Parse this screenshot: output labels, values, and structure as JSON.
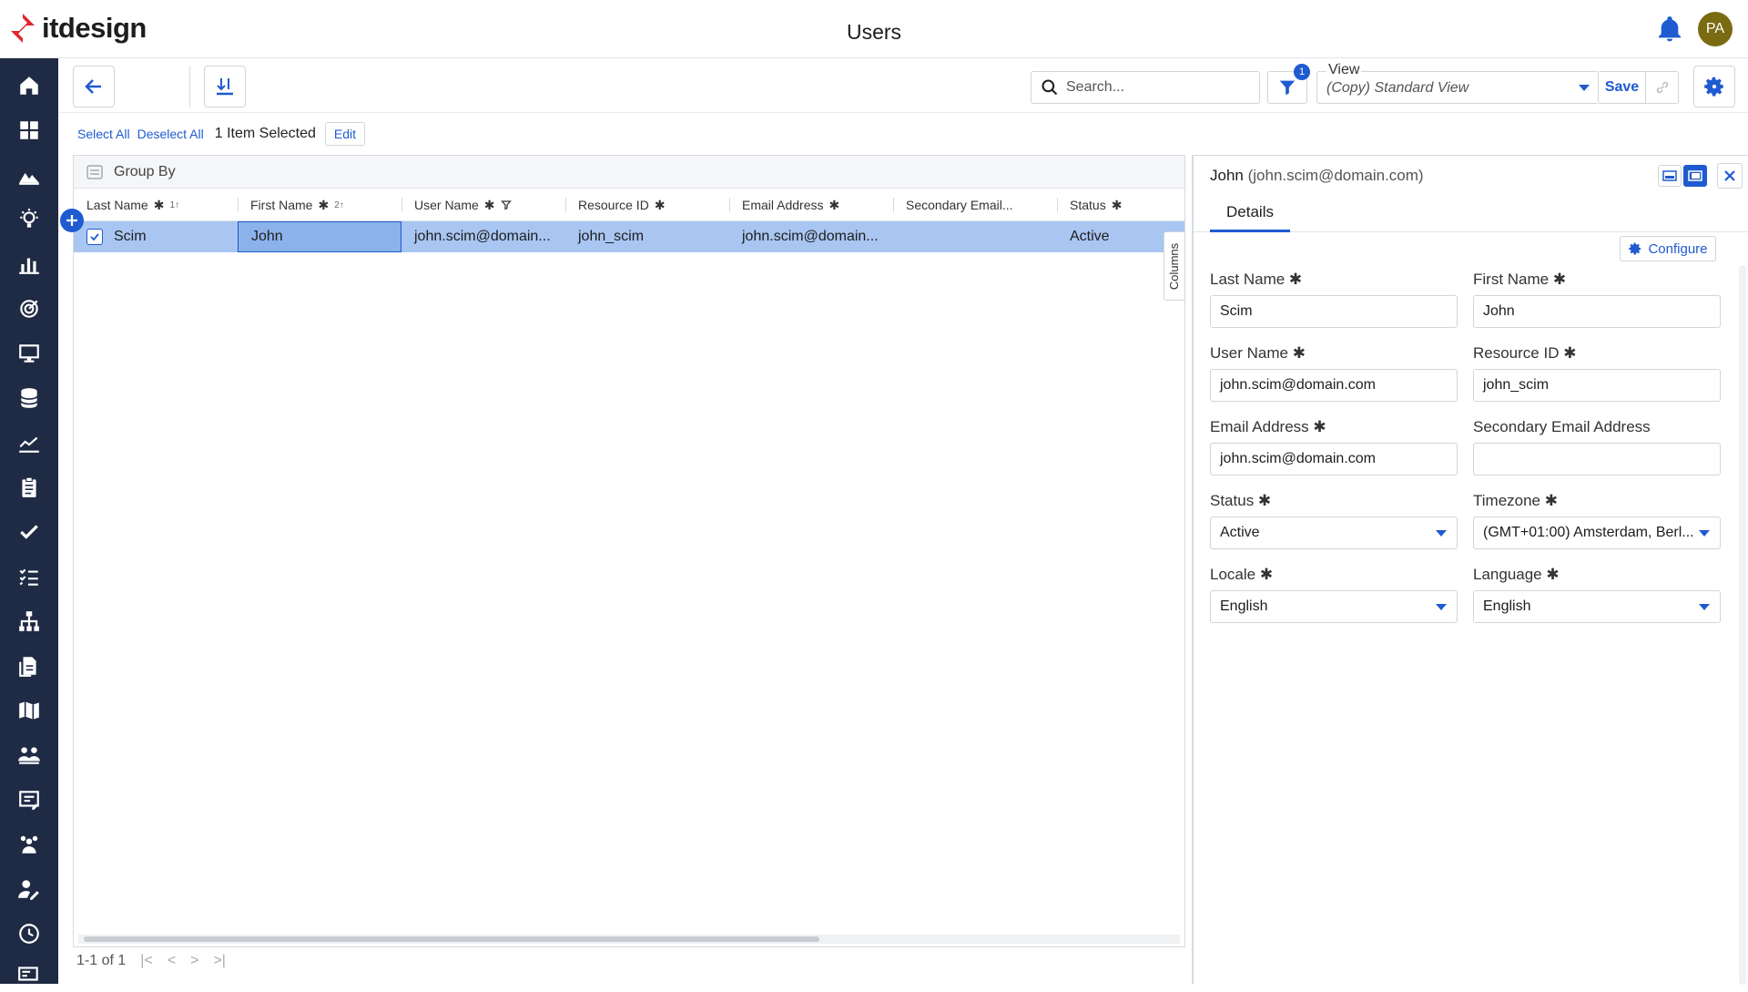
{
  "app": {
    "logo_text": "itdesign",
    "page_title": "Users",
    "avatar_initials": "PA"
  },
  "toolbar": {
    "search_placeholder": "Search...",
    "filter_count": "1",
    "view_label": "View",
    "view_value": "(Copy) Standard View",
    "save_label": "Save"
  },
  "selection": {
    "select_all": "Select All",
    "deselect_all": "Deselect All",
    "count_text": "1 Item Selected",
    "edit_label": "Edit"
  },
  "grid": {
    "group_by_label": "Group By",
    "columns_tab_label": "Columns",
    "columns": [
      {
        "label": "Last Name",
        "sort": "1↑"
      },
      {
        "label": "First Name",
        "sort": "2↑"
      },
      {
        "label": "User Name"
      },
      {
        "label": "Resource ID"
      },
      {
        "label": "Email Address"
      },
      {
        "label": "Secondary Email..."
      },
      {
        "label": "Status"
      }
    ],
    "rows": [
      {
        "last_name": "Scim",
        "first_name": "John",
        "user_name": "john.scim@domain...",
        "resource_id": "john_scim",
        "email": "john.scim@domain...",
        "secondary_email": "",
        "status": "Active"
      }
    ],
    "pager_text": "1-1 of 1"
  },
  "panel": {
    "title": "John",
    "subtitle": "(john.scim@domain.com)",
    "tab_details": "Details",
    "configure_label": "Configure",
    "fields": {
      "last_name": {
        "label": "Last Name",
        "value": "Scim"
      },
      "first_name": {
        "label": "First Name",
        "value": "John"
      },
      "user_name": {
        "label": "User Name",
        "value": "john.scim@domain.com"
      },
      "resource_id": {
        "label": "Resource ID",
        "value": "john_scim"
      },
      "email": {
        "label": "Email Address",
        "value": "john.scim@domain.com"
      },
      "secondary_email": {
        "label": "Secondary Email Address",
        "value": ""
      },
      "status": {
        "label": "Status",
        "value": "Active"
      },
      "timezone": {
        "label": "Timezone",
        "value": "(GMT+01:00) Amsterdam, Berl..."
      },
      "locale": {
        "label": "Locale",
        "value": "English"
      },
      "language": {
        "label": "Language",
        "value": "English"
      }
    }
  },
  "colors": {
    "accent": "#1f5bd0",
    "sidebar": "#1f2a44",
    "selected_row": "#a9c6f2",
    "logo_red": "#e0262f"
  }
}
